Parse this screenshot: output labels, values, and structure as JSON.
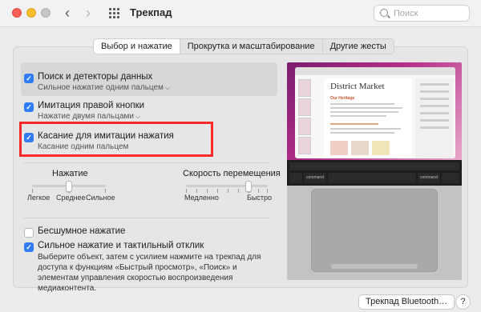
{
  "window": {
    "title": "Трекпад"
  },
  "search": {
    "placeholder": "Поиск"
  },
  "tabs": [
    {
      "label": "Выбор и нажатие",
      "active": true
    },
    {
      "label": "Прокрутка и масштабирование",
      "active": false
    },
    {
      "label": "Другие жесты",
      "active": false
    }
  ],
  "options": [
    {
      "label": "Поиск и детекторы данных",
      "sub": "Сильное нажатие одним пальцем",
      "checked": true,
      "has_dropdown": true
    },
    {
      "label": "Имитация правой кнопки",
      "sub": "Нажатие двумя пальцами",
      "checked": true,
      "has_dropdown": true
    },
    {
      "label": "Касание для имитации нажатия",
      "sub": "Касание одним пальцем",
      "checked": true,
      "has_dropdown": false
    }
  ],
  "click_slider": {
    "title": "Нажатие",
    "labels": [
      "Легкое",
      "Среднее",
      "Сильное"
    ],
    "value_fraction": 0.5
  },
  "speed_slider": {
    "title": "Скорость перемещения",
    "min_label": "Медленно",
    "max_label": "Быстро",
    "value_fraction": 0.76
  },
  "silent_click": {
    "label": "Бесшумное нажатие",
    "checked": false
  },
  "force_click": {
    "label": "Сильное нажатие и тактильный отклик",
    "checked": true,
    "description": "Выберите объект, затем с усилием нажмите на трекпад для доступа к функциям «Быстрый просмотр», «Поиск» и элементам управления скоростью воспроизведения медиаконтента."
  },
  "preview": {
    "doc_title": "District Market",
    "doc_heading": "Our Heritage",
    "keys": [
      "command",
      "command"
    ]
  },
  "footer": {
    "bluetooth_button": "Трекпад Bluetooth…",
    "help_button": "?"
  },
  "colors": {
    "accent": "#2f7cf6",
    "highlight_box": "#ff2a2a"
  }
}
